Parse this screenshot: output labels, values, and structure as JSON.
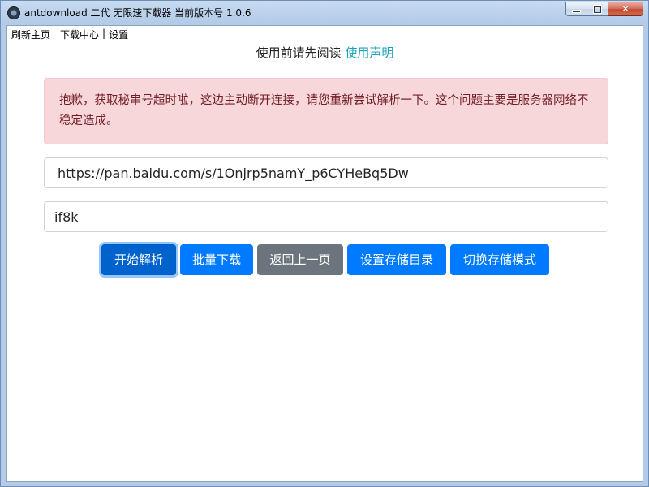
{
  "window": {
    "title": "antdownload 二代 无限速下载器 当前版本号 1.0.6"
  },
  "menu": {
    "items": [
      {
        "label": "刷新主页"
      },
      {
        "label": "下载中心"
      },
      {
        "label": "设置"
      }
    ],
    "separator": "|"
  },
  "notice": {
    "prefix": "使用前请先阅读",
    "link": "使用声明"
  },
  "alert": {
    "message": "抱歉，获取秘串号超时啦，这边主动断开连接，请您重新尝试解析一下。这个问题主要是服务器网络不稳定造成。"
  },
  "form": {
    "url_value": "https://pan.baidu.com/s/1Onjrp5namY_p6CYHeBq5Dw",
    "code_value": "if8k"
  },
  "buttons": [
    {
      "label": "开始解析"
    },
    {
      "label": "批量下载"
    },
    {
      "label": "返回上一页"
    },
    {
      "label": "设置存储目录"
    },
    {
      "label": "切换存储模式"
    }
  ],
  "colors": {
    "primary": "#007bff",
    "secondary": "#6c757d",
    "danger_bg": "#f8d7da",
    "danger_text": "#721c24",
    "link": "#17a2b8"
  }
}
